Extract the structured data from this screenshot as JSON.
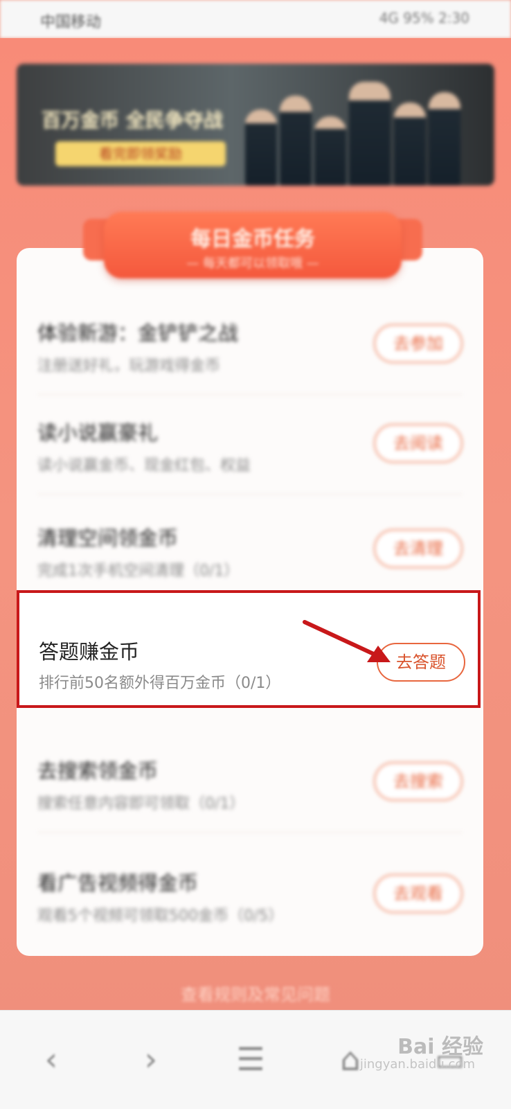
{
  "status_bar": {
    "left": "中国移动",
    "right": "4G 95% 2:30"
  },
  "banner": {
    "title": "百万金币 全民争夺战",
    "pill": "看完即领奖励"
  },
  "section": {
    "title": "每日金币任务",
    "subtitle": "— 每天都可以领取哦 —"
  },
  "tasks": [
    {
      "title": "体验新游：金铲铲之战",
      "subtitle": "注册送好礼，玩游戏得金币",
      "button": "去参加"
    },
    {
      "title": "读小说赢豪礼",
      "subtitle": "读小说赢金币、现金红包、权益",
      "button": "去阅读"
    },
    {
      "title": "清理空间领金币",
      "subtitle": "完成1次手机空间清理（0/1）",
      "button": "去清理"
    },
    {
      "title": "答题赚金币",
      "subtitle": "排行前50名额外得百万金币（0/1）",
      "button": "去答题"
    },
    {
      "title": "去搜索领金币",
      "subtitle": "搜索任意内容即可领取（0/1）",
      "button": "去搜索"
    },
    {
      "title": "看广告视频得金币",
      "subtitle": "观看5个视频可领取500金币（0/5）",
      "button": "去观看"
    }
  ],
  "footer": {
    "link": "查看规则及常见问题"
  },
  "nav": {
    "back": "‹",
    "forward": "›",
    "menu": "☰",
    "home": "⌂",
    "tabs": "▭"
  },
  "watermark": {
    "main": "Bai 经验",
    "sub": "jingyan.baidu.com"
  },
  "colors": {
    "accent": "#e8663e",
    "highlight": "#c8181a",
    "background": "#f49480"
  }
}
